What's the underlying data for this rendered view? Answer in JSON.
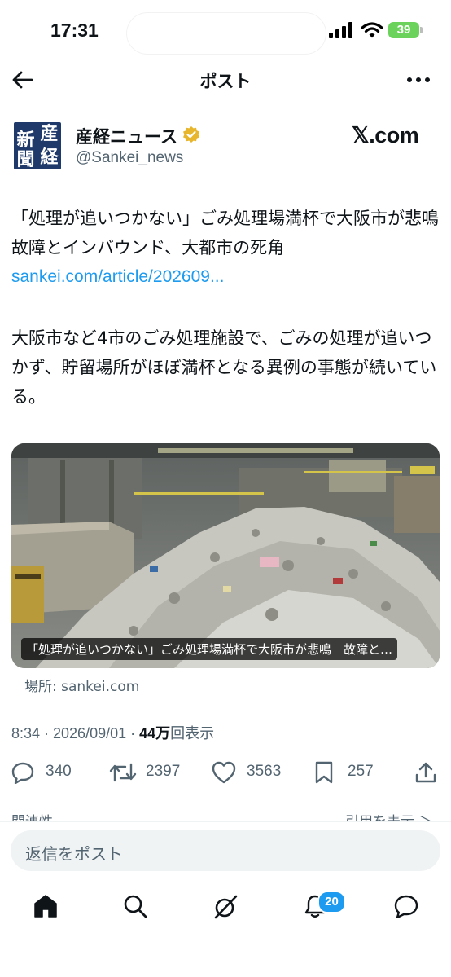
{
  "status": {
    "time": "17:31",
    "battery": "39"
  },
  "header": {
    "title": "ポスト"
  },
  "author": {
    "avatar_chars": [
      "産",
      "新",
      "経",
      "聞"
    ],
    "name": "産経ニュース",
    "handle": "@Sankei_news",
    "brand": "𝕏.com"
  },
  "post": {
    "text1": "「処理が追いつかない」ごみ処理場満杯で大阪市が悲鳴　故障とインバウンド、大都市の死角",
    "link": "sankei.com/article/202609...",
    "text2": "大阪市など4市のごみ処理施設で、ごみの処理が追いつかず、貯留場所がほぼ満杯となる異例の事態が続いている。",
    "media_caption": "「処理が追いつかない」ごみ処理場満杯で大阪市が悲鳴　故障と…",
    "source": "場所: sankei.com",
    "timestamp": "8:34 · 2026/09/01 · ",
    "views_count": "44万",
    "views_label": "回表示"
  },
  "actions": {
    "replies": "340",
    "reposts": "2397",
    "likes": "3563",
    "bookmarks": "257"
  },
  "cut_links": {
    "left": "関連性 ⌄",
    "right": "引用を表示 ＞"
  },
  "reply": {
    "placeholder": "返信をポスト"
  },
  "tabbar": {
    "notifications_badge": "20"
  },
  "colors": {
    "accent": "#1d9bf0",
    "verified": "#e8b62d",
    "muted": "#536471"
  }
}
